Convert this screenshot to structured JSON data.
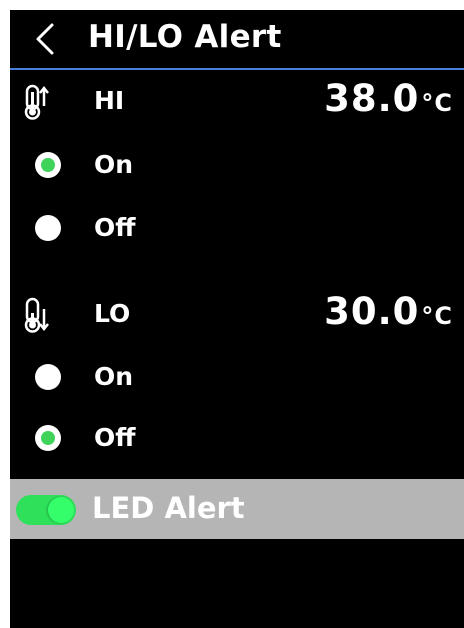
{
  "header": {
    "title": "HI/LO Alert",
    "back_icon": "chevron-left-icon"
  },
  "colors": {
    "background": "#000000",
    "accent_divider": "#4a7fd6",
    "radio_selected": "#3fd35a",
    "toggle_on": "#2fe05a",
    "led_bar": "#b5b5b5"
  },
  "hi": {
    "icon": "thermometer-high-icon",
    "label": "HI",
    "value": "38.0",
    "unit": "°C",
    "options": [
      {
        "label": "On",
        "selected": true
      },
      {
        "label": "Off",
        "selected": false
      }
    ]
  },
  "lo": {
    "icon": "thermometer-low-icon",
    "label": "LO",
    "value": "30.0",
    "unit": "°C",
    "options": [
      {
        "label": "On",
        "selected": false
      },
      {
        "label": "Off",
        "selected": true
      }
    ]
  },
  "led_alert": {
    "label": "LED Alert",
    "enabled": true
  }
}
